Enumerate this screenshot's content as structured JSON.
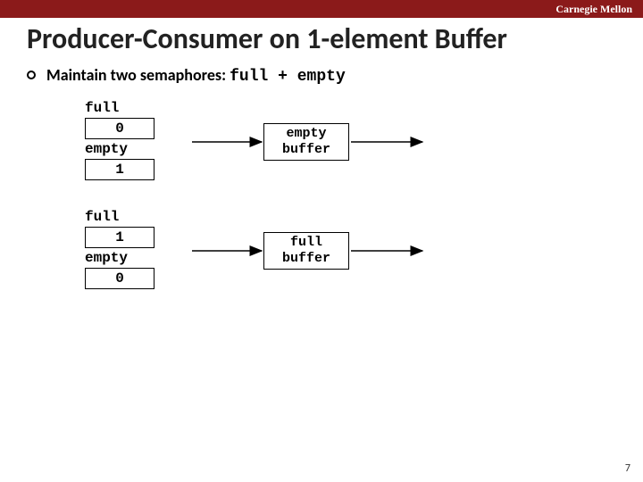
{
  "header": {
    "university": "Carnegie Mellon"
  },
  "title": "Producer-Consumer on 1-element Buffer",
  "bullet": {
    "text_pre": "Maintain two semaphores: ",
    "sem1": "full",
    "plus": " + ",
    "sem2": "empty"
  },
  "group1": {
    "full_label": "full",
    "full_value": "0",
    "empty_label": "empty",
    "empty_value": "1",
    "buffer_l1": "empty",
    "buffer_l2": "buffer"
  },
  "group2": {
    "full_label": "full",
    "full_value": "1",
    "empty_label": "empty",
    "empty_value": "0",
    "buffer_l1": "full",
    "buffer_l2": "buffer"
  },
  "page_number": "7"
}
